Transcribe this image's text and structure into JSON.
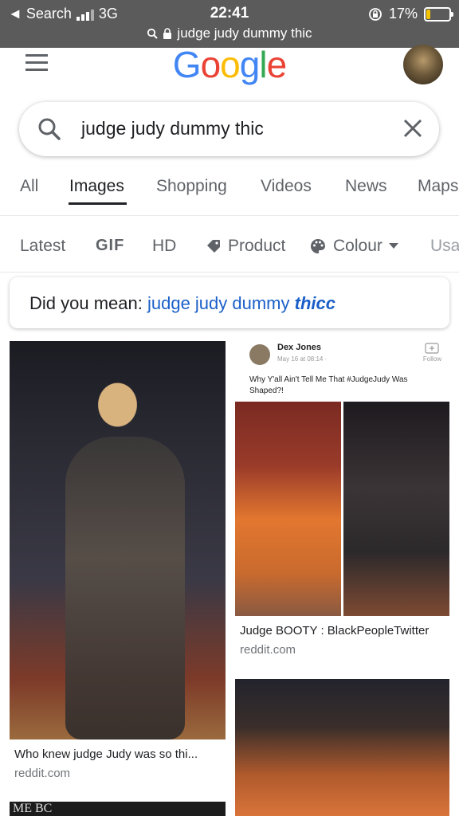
{
  "status_bar": {
    "back_label": "◄ Search",
    "network": "3G",
    "time": "22:41",
    "battery_percent": "17%",
    "battery_level": 0.17,
    "url": "judge judy dummy thic"
  },
  "header": {
    "logo": "Google"
  },
  "search": {
    "query": "judge judy dummy thic"
  },
  "tabs": [
    "All",
    "Images",
    "Shopping",
    "Videos",
    "News",
    "Maps"
  ],
  "active_tab": "Images",
  "filters": [
    "Latest",
    "GIF",
    "HD",
    "Product",
    "Colour",
    "Usa"
  ],
  "did_you_mean": {
    "prefix": "Did you mean: ",
    "suggestion": "judge judy dummy ",
    "correction": "thicc"
  },
  "results": [
    {
      "title": "Who knew judge Judy was so thi...",
      "domain": "reddit.com"
    },
    {
      "title": "Judge BOOTY : BlackPeopleTwitter",
      "domain": "reddit.com"
    }
  ],
  "tweet": {
    "name": "Dex Jones",
    "date": "May 16 at 08:14 ·",
    "follow": "Follow",
    "text": "Why Y'all Ain't Tell Me That #JudgeJudy Was Shaped?!"
  },
  "partial_image_text": "ME  BC",
  "colors": {
    "status_bar_bg": "#5b5b5b",
    "link_blue": "#1a5fc8",
    "battery_yellow": "#f5c400"
  }
}
